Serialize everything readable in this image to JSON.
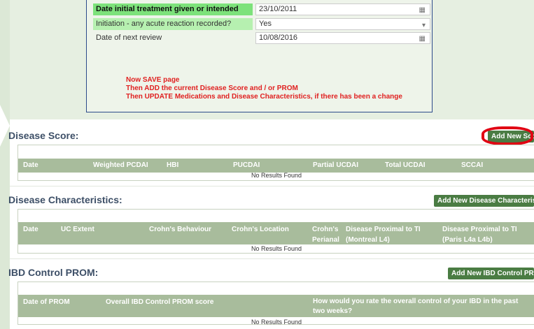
{
  "form": {
    "rows": [
      {
        "label": "Date initial treatment given or intended",
        "value": "23/10/2011",
        "icon": "calendar-icon"
      },
      {
        "label": "Initiation - any acute reaction recorded?",
        "value": "Yes",
        "icon": "dropdown-arrow-icon"
      },
      {
        "label": "Date of next review",
        "value": "10/08/2016",
        "icon": "calendar-icon"
      }
    ],
    "notes": [
      "Now SAVE page",
      "Then ADD the current Disease Score and / or PROM",
      "Then UPDATE Medications and Disease Characteristics, if there has been a change"
    ]
  },
  "disease_score": {
    "title": "Disease Score:",
    "button": "Add New Score",
    "columns": [
      "Date",
      "Weighted PCDAI",
      "HBI",
      "PUCDAI",
      "Partial UCDAI",
      "Total UCDAI",
      "SCCAI"
    ],
    "empty": "No Results Found"
  },
  "disease_characteristics": {
    "title": "Disease Characteristics:",
    "button": "Add New Disease Characteristics",
    "columns": [
      "Date",
      "UC Extent",
      "Crohn's Behaviour",
      "Crohn's Location",
      "Crohn's Perianal",
      "Disease Proximal to TI (Montreal L4)",
      "Disease Proximal to TI (Paris L4a L4b)"
    ],
    "empty": "No Results Found"
  },
  "ibd_prom": {
    "title": "IBD Control PROM:",
    "button": "Add New IBD Control PROM",
    "columns": [
      "Date of PROM",
      "Overall IBD Control PROM score",
      "How would you rate the overall control of your IBD in the past two weeks?"
    ],
    "empty": "No Results Found"
  },
  "colors": {
    "accent_green": "#4a7c43",
    "header_green": "#a8bc9c",
    "highlight_green": "#7de27b",
    "notes_red": "#e02020",
    "circle_red": "#e00012"
  }
}
